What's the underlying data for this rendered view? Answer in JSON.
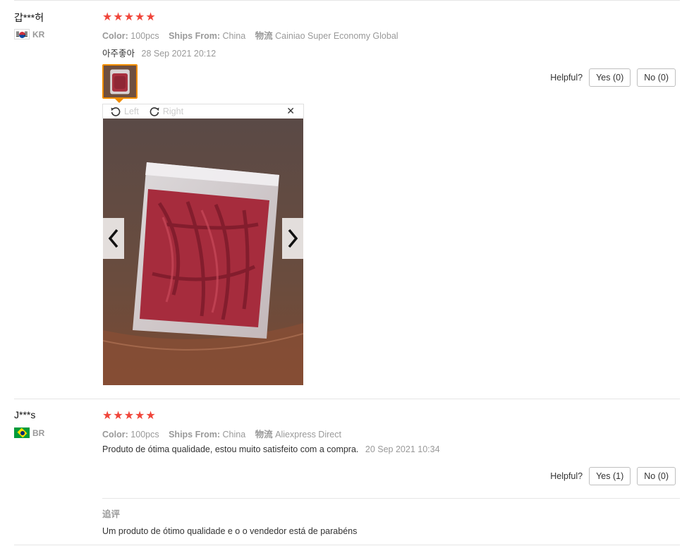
{
  "reviews": [
    {
      "username": "갑***허",
      "country": "KR",
      "stars": [
        "★",
        "★",
        "★",
        "★",
        "★"
      ],
      "color_label": "Color:",
      "color_value": "100pcs",
      "ships_label": "Ships From:",
      "ships_value": "China",
      "logistics_label": "物流",
      "logistics_value": "Cainiao Super Economy Global",
      "comment": "아주좋아",
      "date": "28 Sep 2021 20:12",
      "helpful_label": "Helpful?",
      "yes_label": "Yes (0)",
      "no_label": "No (0)",
      "viewer": {
        "rotate_left": "Left",
        "rotate_right": "Right",
        "close": "✕"
      }
    },
    {
      "username": "J***s",
      "country": "BR",
      "stars": [
        "★",
        "★",
        "★",
        "★",
        "★"
      ],
      "color_label": "Color:",
      "color_value": "100pcs",
      "ships_label": "Ships From:",
      "ships_value": "China",
      "logistics_label": "物流",
      "logistics_value": "Aliexpress Direct",
      "comment": "Produto de ótima qualidade, estou muito satisfeito com a compra.",
      "date": "20 Sep 2021 10:34",
      "helpful_label": "Helpful?",
      "yes_label": "Yes (1)",
      "no_label": "No (0)",
      "followup_label": "追评",
      "followup_text": "Um produto de ótimo qualidade e o o vendedor está de parabéns"
    }
  ],
  "colors": {
    "star": "#f0453a",
    "selected_thumb": "#f08c00",
    "muted_text": "#999999"
  },
  "icons": [
    "rotate-left-icon",
    "rotate-right-icon",
    "close-icon",
    "chevron-left-icon",
    "chevron-right-icon",
    "star-icon"
  ]
}
